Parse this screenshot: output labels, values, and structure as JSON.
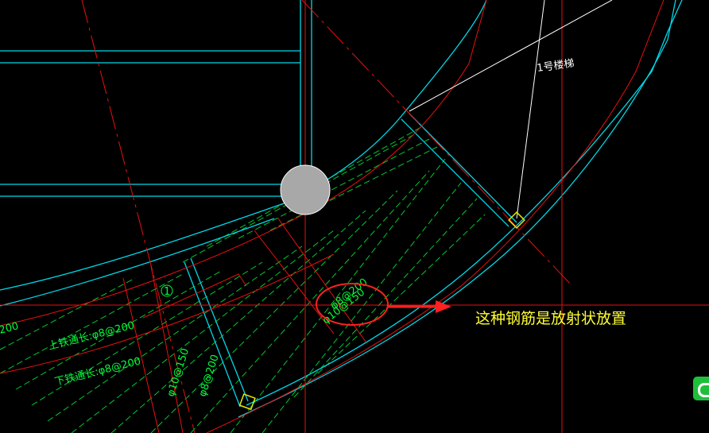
{
  "labels": {
    "stair_label": "1号楼梯",
    "circled_number": "1",
    "top_bar": "上铁通长:φ8@200",
    "bottom_bar": "下铁通长:φ8@200",
    "rebar_a": "φ10@150",
    "rebar_b": "φ8@200",
    "circled_rebar_1": "φ8@200",
    "circled_rebar_2": "φ10@150",
    "left_edge_fragment": "200"
  },
  "annotation": {
    "text": "这种钢筋是放射状放置",
    "arrow_color": "#ff2020",
    "text_color": "#ffff33"
  },
  "colors": {
    "background": "#000000",
    "cyan_lines": "#00d8e8",
    "red_lines": "#e81010",
    "green_hatch": "#00c832",
    "text_green": "#00ff3c",
    "marker_yellow": "#e8e800",
    "circle_fill": "#a8a8a8"
  },
  "icons": [
    "gray-circle-marker",
    "yellow-square-marker",
    "red-ellipse-highlight",
    "red-arrow-icon",
    "watermark-logo-icon"
  ]
}
